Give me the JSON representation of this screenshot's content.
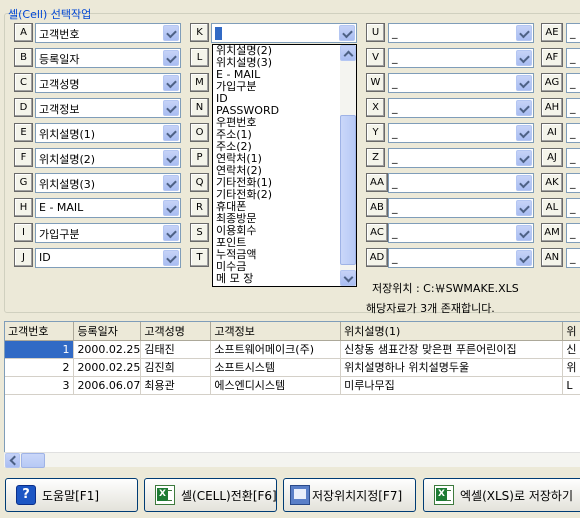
{
  "group_title": "셀(Cell) 선택작업",
  "fields": [
    {
      "letter": "A",
      "value": "고객번호"
    },
    {
      "letter": "B",
      "value": "등록일자"
    },
    {
      "letter": "C",
      "value": "고객성명"
    },
    {
      "letter": "D",
      "value": "고객정보"
    },
    {
      "letter": "E",
      "value": "위치설명(1)"
    },
    {
      "letter": "F",
      "value": "위치설명(2)"
    },
    {
      "letter": "G",
      "value": "위치설명(3)"
    },
    {
      "letter": "H",
      "value": "E - MAIL"
    },
    {
      "letter": "I",
      "value": "가입구분"
    },
    {
      "letter": "J",
      "value": "ID"
    }
  ],
  "fields_k": [
    "K",
    "L",
    "M",
    "N",
    "O",
    "P",
    "Q",
    "R",
    "S",
    "T"
  ],
  "fields_u": [
    "U",
    "V",
    "W",
    "X",
    "Y",
    "Z",
    "AA",
    "AB",
    "AC",
    "AD"
  ],
  "fields_ae": [
    "AE",
    "AF",
    "AG",
    "AH",
    "AI",
    "AJ",
    "AK",
    "AL",
    "AM",
    "AN"
  ],
  "empty_value": "_",
  "dropdown_options": [
    "위치설명(2)",
    "위치설명(3)",
    "E - MAIL",
    "가입구분",
    "ID",
    "PASSWORD",
    "우편번호",
    "주소(1)",
    "주소(2)",
    "연락처(1)",
    "연락처(2)",
    "기타전화(1)",
    "기타전화(2)",
    "휴대폰",
    "최종방문",
    "이용회수",
    "포인트",
    "누적금액",
    "미수금",
    "메 모 장"
  ],
  "save_location": "저장위치 : C:￦SWMAKE.XLS",
  "record_count": "해당자료가 3개 존재합니다.",
  "grid": {
    "columns": [
      "고객번호",
      "등록일자",
      "고객성명",
      "고객정보",
      "위치설명(1)",
      "위"
    ],
    "rows": [
      [
        "1",
        "2000.02.25",
        "김태진",
        "소프트웨어메이크(주)",
        "신창동 샘표간장 맞은편 푸른어린이집",
        "신"
      ],
      [
        "2",
        "2000.02.25",
        "김진희",
        "소프트시스템",
        "위치설명하나 위치설명두울",
        "위"
      ],
      [
        "3",
        "2006.06.07",
        "최용관",
        "에스엔디시스템",
        "미루나무집",
        "L"
      ]
    ]
  },
  "buttons": {
    "help": "도움말[F1]",
    "cell_convert": "셀(CELL)전환[F6]",
    "save_location": "저장위치지정[F7]",
    "excel_save": "엑셀(XLS)로 저장하기"
  }
}
